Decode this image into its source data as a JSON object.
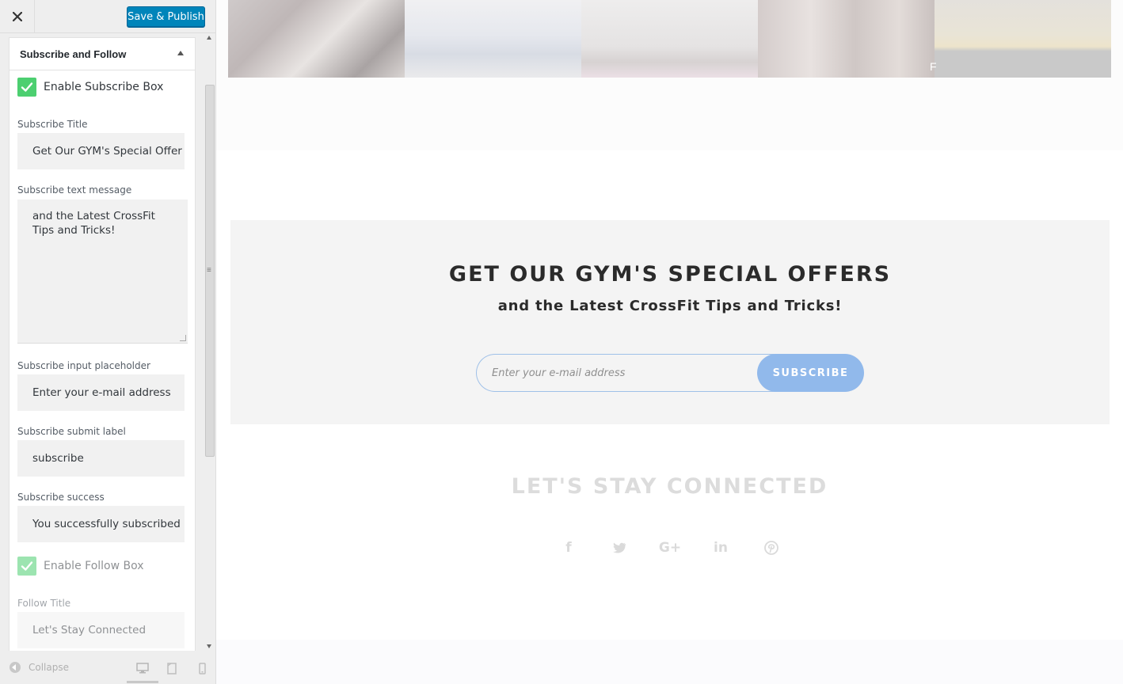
{
  "sidebar": {
    "close_icon": "close-icon",
    "publish_label": "Save & Publish",
    "section_title": "Subscribe and Follow",
    "enable_subscribe_label": "Enable Subscribe Box",
    "enable_subscribe_checked": true,
    "fields": {
      "subscribe_title": {
        "label": "Subscribe Title",
        "value": "Get Our GYM's Special Offer"
      },
      "subscribe_text": {
        "label": "Subscribe text message",
        "value": "and the Latest CrossFit Tips and Tricks!"
      },
      "subscribe_placeholder": {
        "label": "Subscribe input placeholder",
        "value": "Enter your e-mail address"
      },
      "subscribe_submit": {
        "label": "Subscribe submit label",
        "value": "subscribe"
      },
      "subscribe_success": {
        "label": "Subscribe success",
        "value": "You successfully subscribed"
      },
      "follow_title": {
        "label": "Follow Title",
        "value": "Let's Stay Connected"
      }
    },
    "enable_follow_label": "Enable Follow Box",
    "enable_follow_checked": true,
    "collapse_label": "Collapse",
    "check_color": "#4ccf70",
    "accent_color": "#0085ba"
  },
  "preview": {
    "subscribe": {
      "title": "GET OUR GYM'S SPECIAL OFFERS",
      "text": "and the Latest CrossFit Tips and Tricks!",
      "email_placeholder": "Enter your e-mail address",
      "button_label": "SUBSCRIBE",
      "button_color": "#91b9eb"
    },
    "follow": {
      "title": "LET'S STAY CONNECTED",
      "social": [
        {
          "name": "facebook",
          "glyph": "f"
        },
        {
          "name": "twitter",
          "glyph": "t"
        },
        {
          "name": "google-plus",
          "glyph": "G+"
        },
        {
          "name": "linkedin",
          "glyph": "in"
        },
        {
          "name": "pinterest",
          "glyph": "p"
        }
      ]
    },
    "gallery_tile_letter": "F"
  }
}
